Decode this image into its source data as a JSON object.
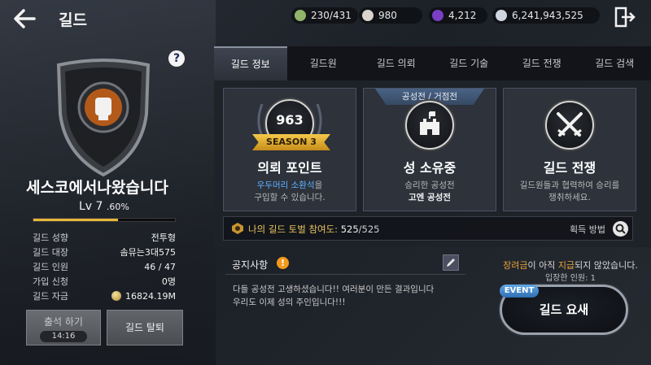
{
  "header": {
    "title": "길드"
  },
  "resources": [
    {
      "name": "guild-points",
      "value": "230/431",
      "color": "#8fb46a"
    },
    {
      "name": "pearl",
      "value": "980",
      "color": "#d8d3cc"
    },
    {
      "name": "gem",
      "value": "4,212",
      "color": "#7a3fc4"
    },
    {
      "name": "silver",
      "value": "6,241,943,525",
      "color": "#cfd6df"
    }
  ],
  "guild": {
    "name": "세스코에서나왔습니다",
    "level": "Lv 7",
    "percent": ".60%",
    "xp_fraction": 0.6,
    "info": [
      {
        "label": "길드 성향",
        "value": "전투형"
      },
      {
        "label": "길드 대장",
        "value": "솜뮤는3대575"
      },
      {
        "label": "길드 인원",
        "value": "46 / 47"
      },
      {
        "label": "가입 신청",
        "value": "0명"
      },
      {
        "label": "길드 자금",
        "value": "16824.19M"
      }
    ]
  },
  "buttons": {
    "attendance": "출석 하기",
    "attendance_time": "14:16",
    "leave": "길드 탈퇴",
    "help": "?",
    "raid": "길드 요새",
    "event": "EVENT",
    "how_to_get": "획득 방법"
  },
  "tabs": [
    "길드 정보",
    "길드원",
    "길드 의뢰",
    "길드 기술",
    "길드 전쟁",
    "길드 검색"
  ],
  "cards": {
    "points": {
      "value": "963",
      "season": "SEASON 3",
      "title": "의뢰 포인트",
      "desc_link": "우두머리 소환석",
      "desc_rest": "을",
      "desc2": "구입할 수 있습니다."
    },
    "castle": {
      "tag": "공성전 / 거점전",
      "title": "성 소유중",
      "desc1": "승리한 공성전",
      "desc2": "고엔 공성전"
    },
    "war": {
      "title": "길드 전쟁",
      "desc1": "길드원들과 협력하여 승리를",
      "desc2": "쟁취하세요."
    }
  },
  "score": {
    "label": "나의 길드 토벌 참여도:",
    "value": "525",
    "max": "/525"
  },
  "notice": {
    "title": "공지사항",
    "warn": "!",
    "line1": "다들 공성전 고생하셨습니다!! 여러분이 만든 결과입니다",
    "line2": "우리도 이제 성의 주인입니다!!!"
  },
  "fortress": {
    "msg_highlight": "장려금",
    "msg_mid": "이 아직 ",
    "msg_strong": "지급",
    "msg_end": "되지 않았습니다.",
    "entrants": "입장한 인원: 1"
  }
}
